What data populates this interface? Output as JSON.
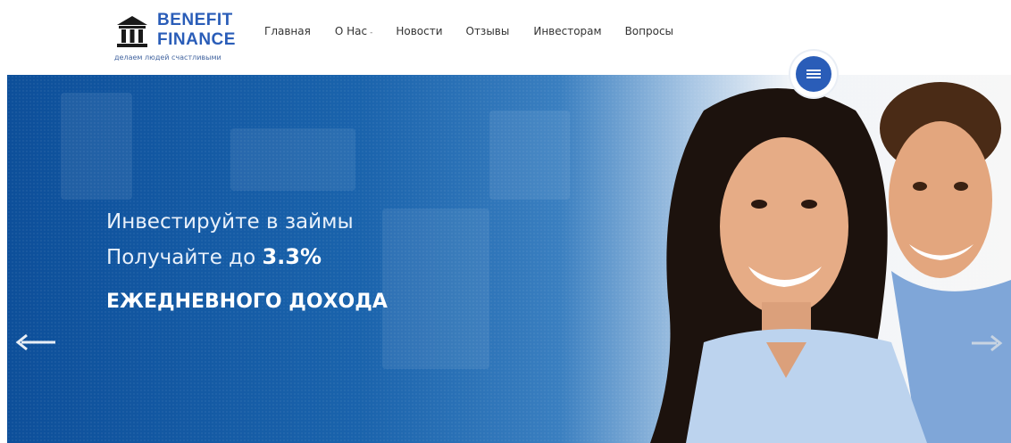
{
  "brand": {
    "name_line1": "BENEFIT",
    "name_line2": "FINANCE",
    "tagline": "делаем людей счастливыми"
  },
  "nav": {
    "items": [
      {
        "label": "Главная"
      },
      {
        "label": "О Нас"
      },
      {
        "label": "Новости"
      },
      {
        "label": "Отзывы"
      },
      {
        "label": "Инвесторам"
      },
      {
        "label": "Вопросы"
      }
    ],
    "dropdown_caret": "-"
  },
  "hero": {
    "line1": "Инвестируйте в займы",
    "line2_prefix": "Получайте до ",
    "line2_value": "3.3%",
    "line3": "ЕЖЕДНЕВНОГО ДОХОДА"
  },
  "colors": {
    "brand_blue": "#2a5db8",
    "hero_blue": "#0d4f9a",
    "text_white": "#ffffff"
  },
  "icons": {
    "logo": "bank-building-icon",
    "menu": "menu-toggle-icon",
    "prev": "arrow-left-icon",
    "next": "arrow-right-icon"
  }
}
